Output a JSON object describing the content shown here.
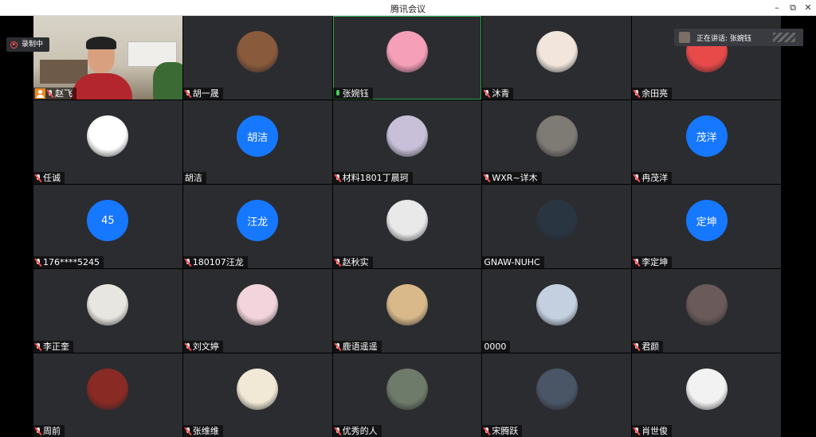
{
  "window": {
    "title": "腾讯会议",
    "controls": {
      "minimize": "–",
      "restore": "⧉",
      "close": "✕"
    }
  },
  "recording": {
    "label": "录制中"
  },
  "speaking": {
    "label": "正在讲话: 张婉钰"
  },
  "participants": [
    {
      "name": "赵飞",
      "avatar": "video",
      "host": true,
      "mic": "muted"
    },
    {
      "name": "胡一晟",
      "avatar": "image",
      "color": "#8a5a3c",
      "mic": "muted"
    },
    {
      "name": "张婉钰",
      "avatar": "image",
      "color": "#f5a0b8",
      "mic": "on",
      "active": true
    },
    {
      "name": "沐青",
      "avatar": "image",
      "color": "#f2e6dc",
      "mic": "muted"
    },
    {
      "name": "余田亮",
      "avatar": "image",
      "color": "#e84a4a",
      "mic": "muted"
    },
    {
      "name": "任诚",
      "avatar": "image",
      "color": "#ffffff",
      "mic": "muted"
    },
    {
      "name": "胡洁",
      "avatar": "text",
      "text": "胡洁",
      "mic": "none"
    },
    {
      "name": "材料1801丁晨珂",
      "avatar": "image",
      "color": "#c8c0d8",
      "mic": "muted"
    },
    {
      "name": "WXR~详木",
      "avatar": "image",
      "color": "#7e7a74",
      "mic": "muted"
    },
    {
      "name": "冉茂洋",
      "avatar": "text",
      "text": "茂洋",
      "mic": "muted"
    },
    {
      "name": "176****5245",
      "avatar": "text",
      "text": "45",
      "mic": "muted"
    },
    {
      "name": "180107汪龙",
      "avatar": "text",
      "text": "汪龙",
      "mic": "muted"
    },
    {
      "name": "赵秋实",
      "avatar": "image",
      "color": "#e9e9e9",
      "mic": "muted"
    },
    {
      "name": "GNAW-NUHC",
      "avatar": "image",
      "color": "#2a3542",
      "mic": "none"
    },
    {
      "name": "李定坤",
      "avatar": "text",
      "text": "定坤",
      "mic": "muted"
    },
    {
      "name": "李正奎",
      "avatar": "image",
      "color": "#e8e6e0",
      "mic": "muted"
    },
    {
      "name": "刘文婷",
      "avatar": "image",
      "color": "#f3d4dc",
      "mic": "muted"
    },
    {
      "name": "鹿语遥遥",
      "avatar": "image",
      "color": "#d9b98a",
      "mic": "muted"
    },
    {
      "name": "0000",
      "avatar": "image",
      "color": "#c4d0e0",
      "mic": "none"
    },
    {
      "name": "君颜",
      "avatar": "image",
      "color": "#6a5a5a",
      "mic": "muted"
    },
    {
      "name": "周前",
      "avatar": "image",
      "color": "#8a2a24",
      "mic": "muted"
    },
    {
      "name": "张维维",
      "avatar": "image",
      "color": "#f1e8d6",
      "mic": "muted"
    },
    {
      "name": "优秀的人",
      "avatar": "image",
      "color": "#6e7a6a",
      "mic": "muted"
    },
    {
      "name": "宋腾跃",
      "avatar": "image",
      "color": "#4a5566",
      "mic": "muted"
    },
    {
      "name": "肖世俊",
      "avatar": "image",
      "color": "#f2f2f2",
      "mic": "muted"
    }
  ]
}
